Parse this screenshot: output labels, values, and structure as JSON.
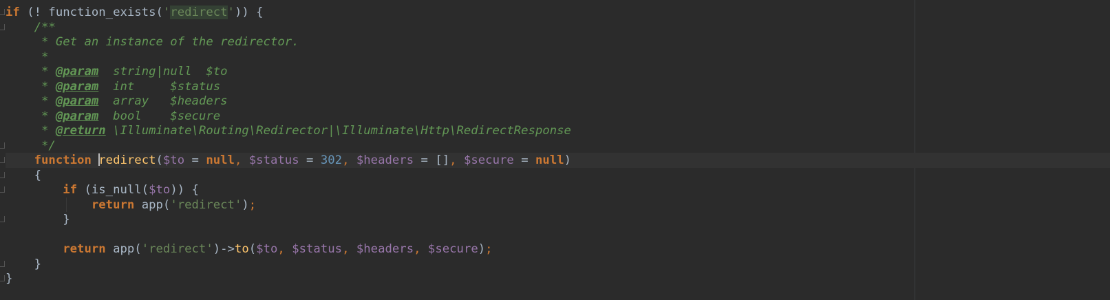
{
  "editor": {
    "language": "PHP",
    "lines": [
      {
        "tokens": [
          {
            "t": "kw",
            "v": "if"
          },
          {
            "t": "plain",
            "v": " (! function_exists("
          },
          {
            "t": "str",
            "v": "'"
          },
          {
            "t": "str-hl",
            "v": "redirect"
          },
          {
            "t": "str",
            "v": "'"
          },
          {
            "t": "plain",
            "v": ")) {"
          }
        ]
      },
      {
        "tokens": [
          {
            "t": "plain",
            "v": "    "
          },
          {
            "t": "doc",
            "v": "/**"
          }
        ]
      },
      {
        "tokens": [
          {
            "t": "plain",
            "v": "     "
          },
          {
            "t": "doc",
            "v": "* Get an instance of the redirector."
          }
        ]
      },
      {
        "tokens": [
          {
            "t": "plain",
            "v": "     "
          },
          {
            "t": "doc",
            "v": "*"
          }
        ]
      },
      {
        "tokens": [
          {
            "t": "plain",
            "v": "     "
          },
          {
            "t": "doc",
            "v": "* "
          },
          {
            "t": "doctag",
            "v": "@param"
          },
          {
            "t": "doc",
            "v": "  string|null  $to"
          }
        ]
      },
      {
        "tokens": [
          {
            "t": "plain",
            "v": "     "
          },
          {
            "t": "doc",
            "v": "* "
          },
          {
            "t": "doctag",
            "v": "@param"
          },
          {
            "t": "doc",
            "v": "  int     $status"
          }
        ]
      },
      {
        "tokens": [
          {
            "t": "plain",
            "v": "     "
          },
          {
            "t": "doc",
            "v": "* "
          },
          {
            "t": "doctag",
            "v": "@param"
          },
          {
            "t": "doc",
            "v": "  array   $headers"
          }
        ]
      },
      {
        "tokens": [
          {
            "t": "plain",
            "v": "     "
          },
          {
            "t": "doc",
            "v": "* "
          },
          {
            "t": "doctag",
            "v": "@param"
          },
          {
            "t": "doc",
            "v": "  bool    $secure"
          }
        ]
      },
      {
        "tokens": [
          {
            "t": "plain",
            "v": "     "
          },
          {
            "t": "doc",
            "v": "* "
          },
          {
            "t": "doctag",
            "v": "@return"
          },
          {
            "t": "doc",
            "v": " \\Illuminate\\Routing\\Redirector|\\Illuminate\\Http\\RedirectResponse"
          }
        ]
      },
      {
        "tokens": [
          {
            "t": "plain",
            "v": "     "
          },
          {
            "t": "doc",
            "v": "*/"
          }
        ]
      },
      {
        "current": true,
        "tokens": [
          {
            "t": "plain",
            "v": "    "
          },
          {
            "t": "kw",
            "v": "function"
          },
          {
            "t": "plain",
            "v": " "
          },
          {
            "t": "caret",
            "v": ""
          },
          {
            "t": "fn",
            "v": "redirect"
          },
          {
            "t": "plain",
            "v": "("
          },
          {
            "t": "var",
            "v": "$to"
          },
          {
            "t": "plain",
            "v": " = "
          },
          {
            "t": "kw",
            "v": "null"
          },
          {
            "t": "punct",
            "v": ", "
          },
          {
            "t": "var",
            "v": "$status"
          },
          {
            "t": "plain",
            "v": " = "
          },
          {
            "t": "num",
            "v": "302"
          },
          {
            "t": "punct",
            "v": ", "
          },
          {
            "t": "var",
            "v": "$headers"
          },
          {
            "t": "plain",
            "v": " = []"
          },
          {
            "t": "punct",
            "v": ", "
          },
          {
            "t": "var",
            "v": "$secure"
          },
          {
            "t": "plain",
            "v": " = "
          },
          {
            "t": "kw",
            "v": "null"
          },
          {
            "t": "plain",
            "v": ")"
          }
        ]
      },
      {
        "tokens": [
          {
            "t": "plain",
            "v": "    {"
          }
        ]
      },
      {
        "tokens": [
          {
            "t": "plain",
            "v": "        "
          },
          {
            "t": "kw",
            "v": "if"
          },
          {
            "t": "plain",
            "v": " (is_null("
          },
          {
            "t": "var",
            "v": "$to"
          },
          {
            "t": "plain",
            "v": ")) {"
          }
        ]
      },
      {
        "tokens": [
          {
            "t": "plain",
            "v": "            "
          },
          {
            "t": "kw",
            "v": "return"
          },
          {
            "t": "plain",
            "v": " app("
          },
          {
            "t": "str",
            "v": "'redirect'"
          },
          {
            "t": "plain",
            "v": ")"
          },
          {
            "t": "punct",
            "v": ";"
          }
        ]
      },
      {
        "tokens": [
          {
            "t": "plain",
            "v": "        }"
          }
        ]
      },
      {
        "tokens": [
          {
            "t": "plain",
            "v": ""
          }
        ]
      },
      {
        "tokens": [
          {
            "t": "plain",
            "v": "        "
          },
          {
            "t": "kw",
            "v": "return"
          },
          {
            "t": "plain",
            "v": " app("
          },
          {
            "t": "str",
            "v": "'redirect'"
          },
          {
            "t": "plain",
            "v": ")->"
          },
          {
            "t": "fn",
            "v": "to"
          },
          {
            "t": "plain",
            "v": "("
          },
          {
            "t": "var",
            "v": "$to"
          },
          {
            "t": "punct",
            "v": ", "
          },
          {
            "t": "var",
            "v": "$status"
          },
          {
            "t": "punct",
            "v": ", "
          },
          {
            "t": "var",
            "v": "$headers"
          },
          {
            "t": "punct",
            "v": ", "
          },
          {
            "t": "var",
            "v": "$secure"
          },
          {
            "t": "plain",
            "v": ")"
          },
          {
            "t": "punct",
            "v": ";"
          }
        ]
      },
      {
        "tokens": [
          {
            "t": "plain",
            "v": "    }"
          }
        ]
      },
      {
        "tokens": [
          {
            "t": "plain",
            "v": "}"
          }
        ]
      }
    ]
  },
  "colors": {
    "background": "#2b2b2b",
    "current_line": "#323232",
    "keyword": "#cc7832",
    "function": "#ffc66d",
    "string": "#6a8759",
    "variable": "#9876aa",
    "number": "#6897bb",
    "doc_comment": "#629755"
  }
}
